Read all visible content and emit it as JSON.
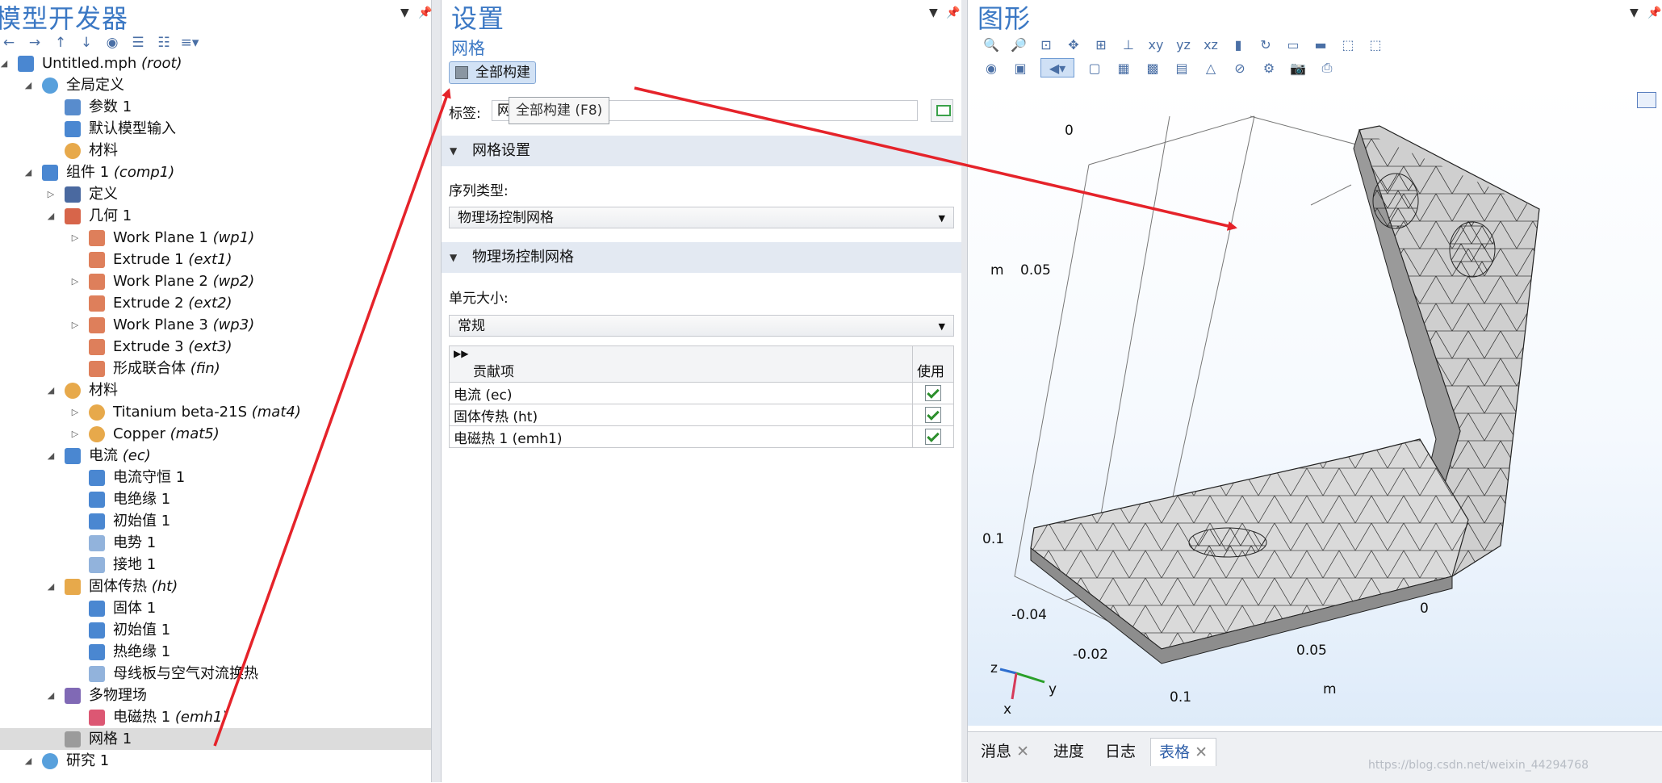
{
  "model_builder": {
    "title": "模型开发器",
    "tree": [
      {
        "label": "Untitled.mph",
        "tag": "(root)"
      },
      {
        "label": "全局定义",
        "tag": ""
      },
      {
        "label": "参数 1",
        "tag": ""
      },
      {
        "label": "默认模型输入",
        "tag": ""
      },
      {
        "label": "材料",
        "tag": ""
      },
      {
        "label": "组件 1",
        "tag": "(comp1)"
      },
      {
        "label": "定义",
        "tag": ""
      },
      {
        "label": "几何 1",
        "tag": ""
      },
      {
        "label": "Work Plane 1",
        "tag": "(wp1)"
      },
      {
        "label": "Extrude 1",
        "tag": "(ext1)"
      },
      {
        "label": "Work Plane 2",
        "tag": "(wp2)"
      },
      {
        "label": "Extrude 2",
        "tag": "(ext2)"
      },
      {
        "label": "Work Plane 3",
        "tag": "(wp3)"
      },
      {
        "label": "Extrude 3",
        "tag": "(ext3)"
      },
      {
        "label": "形成联合体",
        "tag": "(fin)"
      },
      {
        "label": "材料",
        "tag": ""
      },
      {
        "label": "Titanium beta-21S",
        "tag": "(mat4)"
      },
      {
        "label": "Copper",
        "tag": "(mat5)"
      },
      {
        "label": "电流",
        "tag": "(ec)"
      },
      {
        "label": "电流守恒 1",
        "tag": ""
      },
      {
        "label": "电绝缘 1",
        "tag": ""
      },
      {
        "label": "初始值 1",
        "tag": ""
      },
      {
        "label": "电势 1",
        "tag": ""
      },
      {
        "label": "接地 1",
        "tag": ""
      },
      {
        "label": "固体传热",
        "tag": "(ht)"
      },
      {
        "label": "固体 1",
        "tag": ""
      },
      {
        "label": "初始值 1",
        "tag": ""
      },
      {
        "label": "热绝缘 1",
        "tag": ""
      },
      {
        "label": "母线板与空气对流换热",
        "tag": ""
      },
      {
        "label": "多物理场",
        "tag": ""
      },
      {
        "label": "电磁热 1",
        "tag": "(emh1)"
      },
      {
        "label": "网格 1",
        "tag": ""
      },
      {
        "label": "研究 1",
        "tag": ""
      }
    ]
  },
  "settings": {
    "title": "设置",
    "subtitle": "网格",
    "build_all_label": "全部构建",
    "tooltip": "全部构建 (F8)",
    "label_field_label": "标签:",
    "label_field_value": "网",
    "sections": {
      "mesh_settings": "网格设置",
      "physics_controlled": "物理场控制网格"
    },
    "sequence_type_label": "序列类型:",
    "sequence_type_value": "物理场控制网格",
    "element_size_label": "单元大小:",
    "element_size_value": "常规",
    "table": {
      "col_contributor": "贡献项",
      "col_use": "使用",
      "rows": [
        "电流 (ec)",
        "固体传热 (ht)",
        "电磁热 1 (emh1)"
      ]
    }
  },
  "graphics": {
    "title": "图形",
    "axis_labels": {
      "z0": "0",
      "z005": "0.05",
      "z01": "0.1",
      "zunit": "m",
      "x_neg004": "-0.04",
      "x_neg002": "-0.02",
      "y0": "0",
      "y005": "0.05",
      "y01": "0.1",
      "yunit": "m"
    },
    "triad": {
      "z": "z",
      "y": "y",
      "x": "x"
    },
    "bottom_tabs": [
      "消息",
      "进度",
      "日志",
      "表格"
    ],
    "watermark": "https://blog.csdn.net/weixin_44294768"
  },
  "colors": {
    "accent": "#3b78c4",
    "arrow": "#e5232a",
    "section_bg": "#e3e9f2"
  }
}
